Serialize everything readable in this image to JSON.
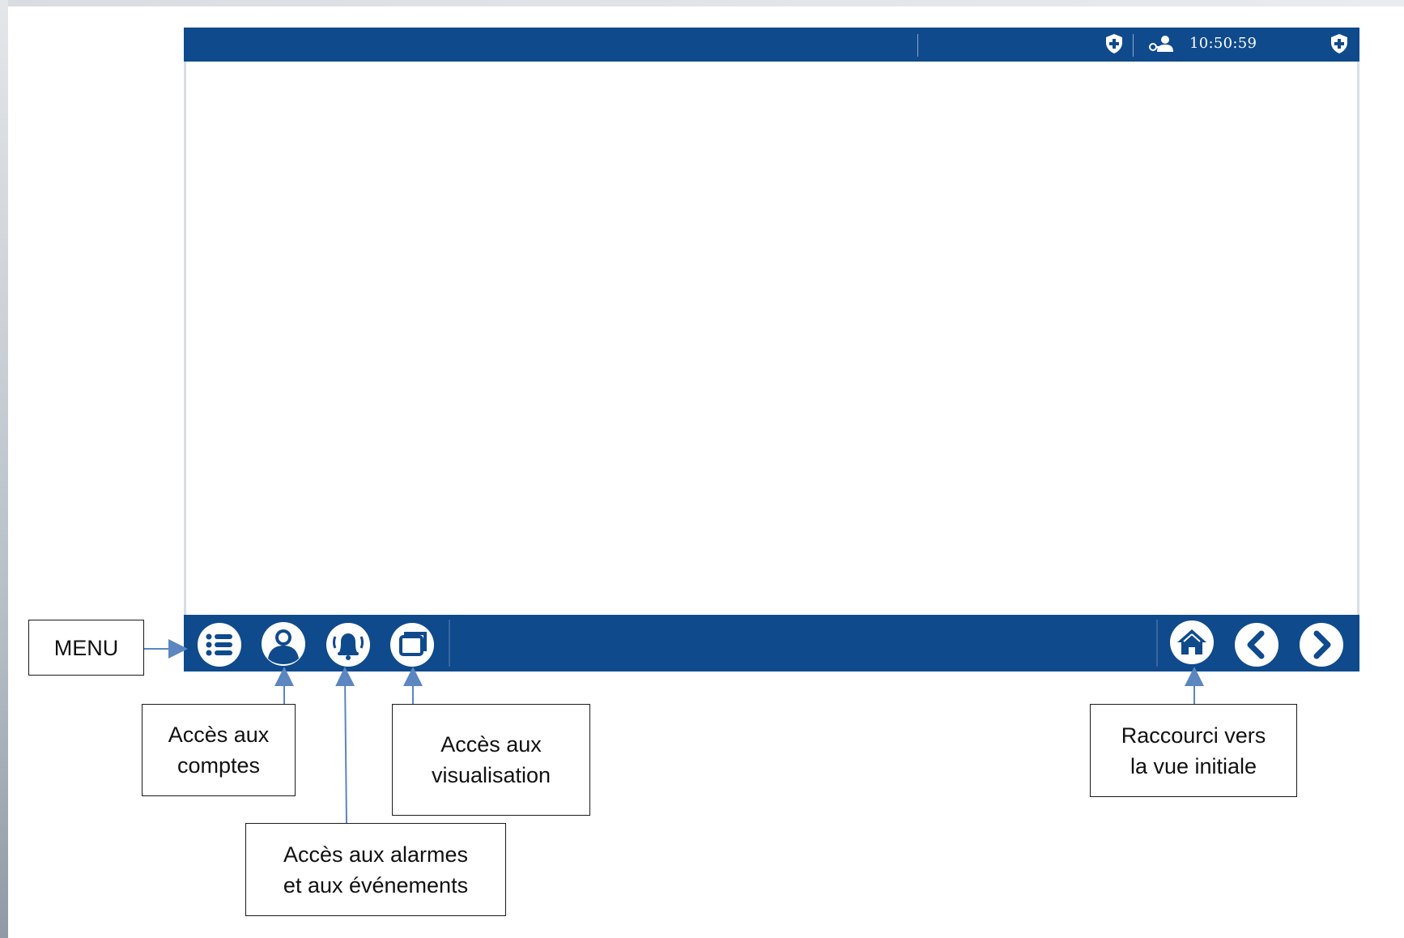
{
  "status_bar": {
    "clock": "10:50:59",
    "icons": [
      "shield-plus-icon",
      "user-key-icon",
      "shield-plus-icon"
    ]
  },
  "nav_bar": {
    "left_buttons": [
      "menu-list-icon",
      "user-account-icon",
      "alarm-bell-icon",
      "windows-icon"
    ],
    "right_buttons": [
      "home-icon",
      "chevron-left-icon",
      "chevron-right-icon"
    ]
  },
  "annotations": {
    "menu": "MENU",
    "accounts": [
      "Accès aux",
      "comptes"
    ],
    "alarms": [
      "Accès aux alarmes",
      "et aux événements"
    ],
    "views": [
      "Accès aux",
      "visualisation"
    ],
    "home": [
      "Raccourci vers",
      "la vue initiale"
    ]
  },
  "colors": {
    "bar_blue": "#0f4a8c",
    "arrow_blue": "#5b86bf"
  }
}
